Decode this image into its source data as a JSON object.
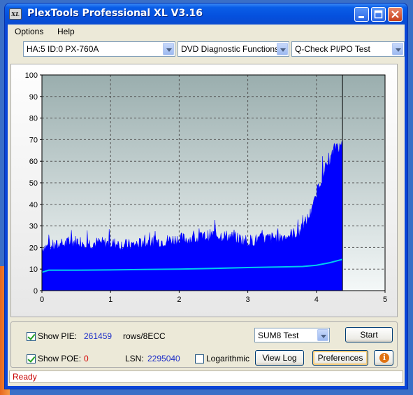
{
  "window": {
    "title": "PlexTools Professional XL V3.16",
    "icon_text": "XL"
  },
  "menu": {
    "options": "Options",
    "help": "Help"
  },
  "toolbar": {
    "drive": "HA:5 ID:0  PX-760A",
    "function": "DVD Diagnostic Functions",
    "test": "Q-Check PI/PO Test"
  },
  "chart_data": {
    "type": "area",
    "xlim": [
      0,
      5
    ],
    "ylim": [
      0,
      100
    ],
    "x_ticks": [
      "0",
      "1",
      "2",
      "3",
      "4",
      "5"
    ],
    "y_ticks": [
      "0",
      "10",
      "20",
      "30",
      "40",
      "50",
      "60",
      "70",
      "80",
      "90",
      "100"
    ],
    "grid": true,
    "end_marker_x": 4.38,
    "series": [
      {
        "color": "#0000ff",
        "x": [
          0,
          0.25,
          0.5,
          0.75,
          1.0,
          1.25,
          1.5,
          1.75,
          2.0,
          2.25,
          2.5,
          2.75,
          3.0,
          3.25,
          3.5,
          3.75,
          3.85,
          3.95,
          4.0,
          4.05,
          4.1,
          4.15,
          4.2,
          4.25,
          4.3,
          4.35,
          4.38
        ],
        "values": [
          20,
          21,
          23,
          22,
          22,
          21,
          22,
          23,
          24,
          24,
          26,
          25,
          23,
          24,
          25,
          27,
          32,
          38,
          45,
          50,
          55,
          58,
          60,
          65,
          68,
          66,
          70
        ]
      },
      {
        "color": "#00ccee",
        "x": [
          0,
          0.1,
          0.5,
          1.0,
          1.5,
          2.0,
          2.5,
          3.0,
          3.5,
          3.8,
          4.0,
          4.2,
          4.38
        ],
        "values": [
          8.5,
          9.5,
          9.5,
          9.6,
          9.8,
          10.0,
          10.3,
          10.7,
          11.0,
          11.2,
          11.8,
          13.0,
          14.5
        ]
      }
    ]
  },
  "pie": {
    "label": "Show PIE:",
    "value": "261459",
    "unit": "rows/8ECC"
  },
  "poe": {
    "label": "Show POE:",
    "value": "0"
  },
  "lsn": {
    "label": "LSN:",
    "value": "2295040"
  },
  "log_label": "Logarithmic",
  "sum_select": "SUM8 Test",
  "buttons": {
    "start": "Start",
    "view_log": "View Log",
    "preferences": "Preferences"
  },
  "status": "Ready",
  "colors": {
    "pie_fill": "#0000ff",
    "poe_line": "#00ccee",
    "plot_bg_top": "#9aaeae",
    "plot_bg_bottom": "#f4f8f8"
  }
}
